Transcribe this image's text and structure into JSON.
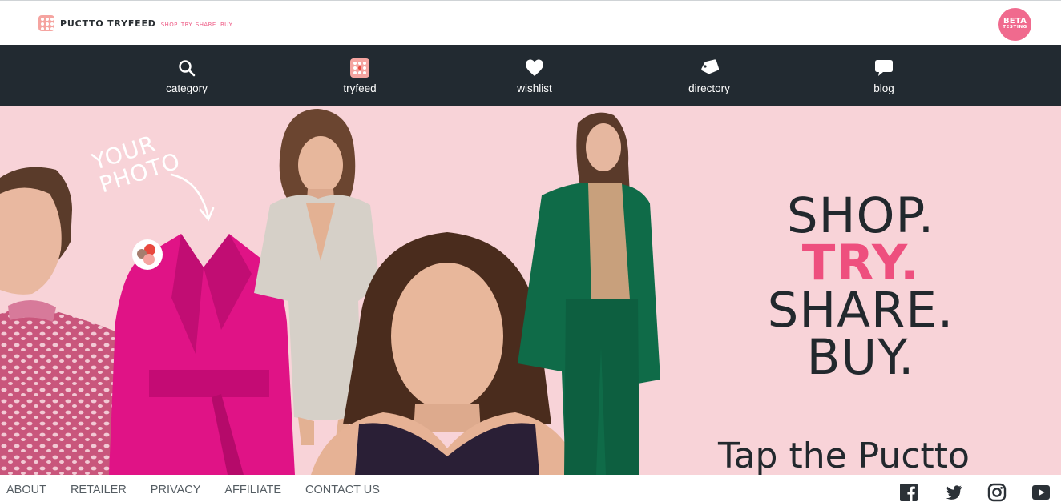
{
  "header": {
    "brand_name": "PUCTTO TRYFEED",
    "brand_tagline": "SHOP. TRY. SHARE. BUY.",
    "badge_line1": "BETA",
    "badge_line2": "TESTING"
  },
  "nav": {
    "items": [
      {
        "label": "category",
        "icon": "search-icon"
      },
      {
        "label": "tryfeed",
        "icon": "tryfeed-logo-icon"
      },
      {
        "label": "wishlist",
        "icon": "heart-icon"
      },
      {
        "label": "directory",
        "icon": "tag-icon"
      },
      {
        "label": "blog",
        "icon": "speech-bubble-icon"
      }
    ]
  },
  "hero": {
    "annotation_line1": "YOUR",
    "annotation_line2": "PHOTO",
    "headline": {
      "line1": "SHOP.",
      "line2": "TRY.",
      "line3": "SHARE.",
      "line4": "BUY."
    },
    "subline": "Tap the Puctto"
  },
  "footer": {
    "links": [
      "ABOUT",
      "RETAILER",
      "PRIVACY",
      "AFFILIATE",
      "CONTACT US"
    ],
    "social": [
      "facebook-icon",
      "twitter-icon",
      "instagram-icon",
      "youtube-icon"
    ]
  },
  "colors": {
    "nav_bg": "#222a31",
    "hero_bg": "#f8d3d8",
    "accent_pink": "#ee4f7e",
    "magenta_coat": "#e01386",
    "green_suit": "#0f6b48"
  }
}
